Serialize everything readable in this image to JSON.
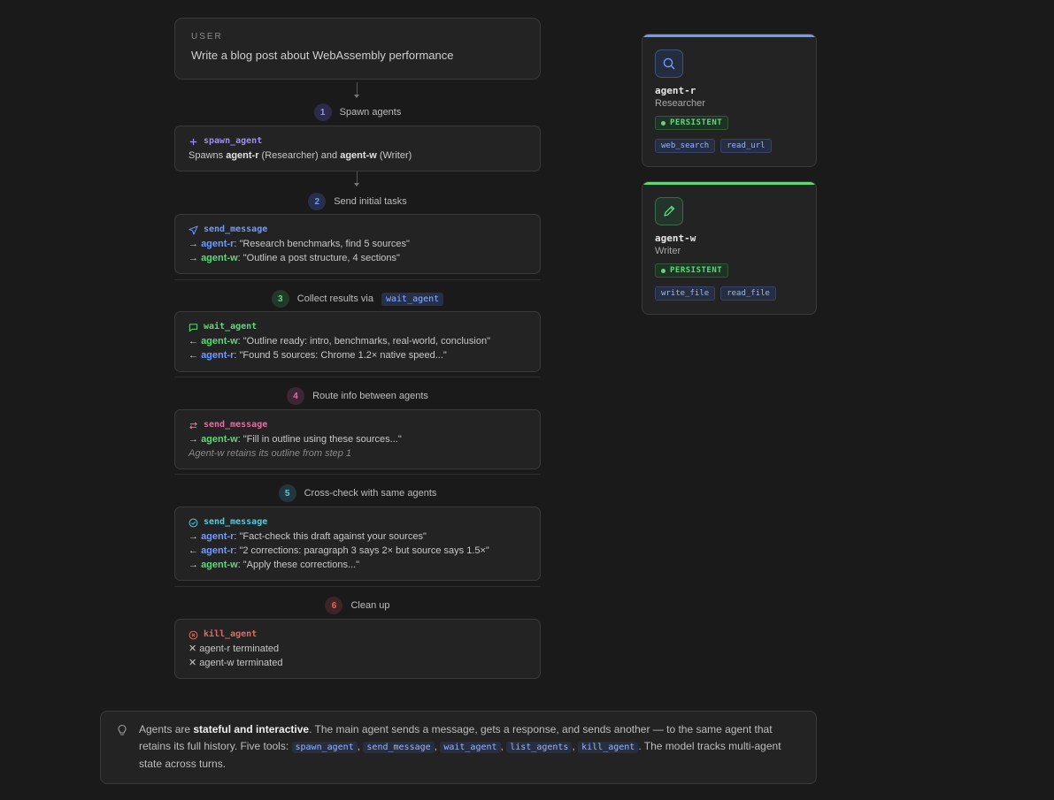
{
  "user": {
    "label": "USER",
    "text": "Write a blog post about WebAssembly performance"
  },
  "colors": {
    "agent_r": "#6f9bff",
    "agent_w": "#5fd87a",
    "step1": "#9b8cff",
    "step2": "#6f9bff",
    "step3": "#5fd87a",
    "step4": "#e0709e",
    "step5": "#5cc8d8",
    "step6": "#e06a5e"
  },
  "steps": [
    {
      "num": "1",
      "title": "Spawn agents",
      "tool": "spawn_agent",
      "icon": "plus-icon",
      "line1": {
        "pre": "Spawns ",
        "a": "agent-r",
        "mid": " (Researcher) and ",
        "b": "agent-w",
        "post": " (Writer)"
      }
    },
    {
      "num": "2",
      "title": "Send initial tasks",
      "tool": "send_message",
      "icon": "send-icon",
      "lines": [
        {
          "arrow": "→",
          "agent": "agent-r",
          "text": ": \"Research benchmarks, find 5 sources\""
        },
        {
          "arrow": "→",
          "agent": "agent-w",
          "text": ": \"Outline a post structure, 4 sections\""
        }
      ]
    },
    {
      "num": "3",
      "title": "Collect results via",
      "title_code": "wait_agent",
      "tool": "wait_agent",
      "icon": "message-icon",
      "lines": [
        {
          "arrow": "←",
          "agent": "agent-w",
          "text": ": \"Outline ready: intro, benchmarks, real-world, conclusion\""
        },
        {
          "arrow": "←",
          "agent": "agent-r",
          "text": ": \"Found 5 sources: Chrome 1.2× native speed...\""
        }
      ]
    },
    {
      "num": "4",
      "title": "Route info between agents",
      "tool": "send_message",
      "icon": "route-icon",
      "lines": [
        {
          "arrow": "→",
          "agent": "agent-w",
          "text": ": \"Fill in outline using these sources...\""
        }
      ],
      "note": "Agent-w retains its outline from step 1"
    },
    {
      "num": "5",
      "title": "Cross-check with same agents",
      "tool": "send_message",
      "icon": "check-circle-icon",
      "lines": [
        {
          "arrow": "→",
          "agent": "agent-r",
          "text": ": \"Fact-check this draft against your sources\""
        },
        {
          "arrow": "←",
          "agent": "agent-r",
          "text": ": \"2 corrections: paragraph 3 says 2× but source says 1.5×\""
        },
        {
          "arrow": "→",
          "agent": "agent-w",
          "text": ": \"Apply these corrections...\""
        }
      ]
    },
    {
      "num": "6",
      "title": "Clean up",
      "tool": "kill_agent",
      "icon": "x-circle-icon",
      "kills": [
        "agent-r terminated",
        "agent-w terminated"
      ]
    }
  ],
  "agents": [
    {
      "name": "agent-r",
      "role": "Researcher",
      "status": "PERSISTENT",
      "tools": [
        "web_search",
        "read_url"
      ],
      "icon": "search-icon"
    },
    {
      "name": "agent-w",
      "role": "Writer",
      "status": "PERSISTENT",
      "tools": [
        "write_file",
        "read_file"
      ],
      "icon": "pencil-icon"
    }
  ],
  "footer": {
    "p1": "Agents are ",
    "strong": "stateful and interactive",
    "p2": ". The main agent sends a message, gets a response, and sends another — to the same agent that retains its full history. Five tools: ",
    "tools": [
      "spawn_agent",
      "send_message",
      "wait_agent",
      "list_agents",
      "kill_agent"
    ],
    "p3": ". The model tracks multi-agent state across turns."
  }
}
